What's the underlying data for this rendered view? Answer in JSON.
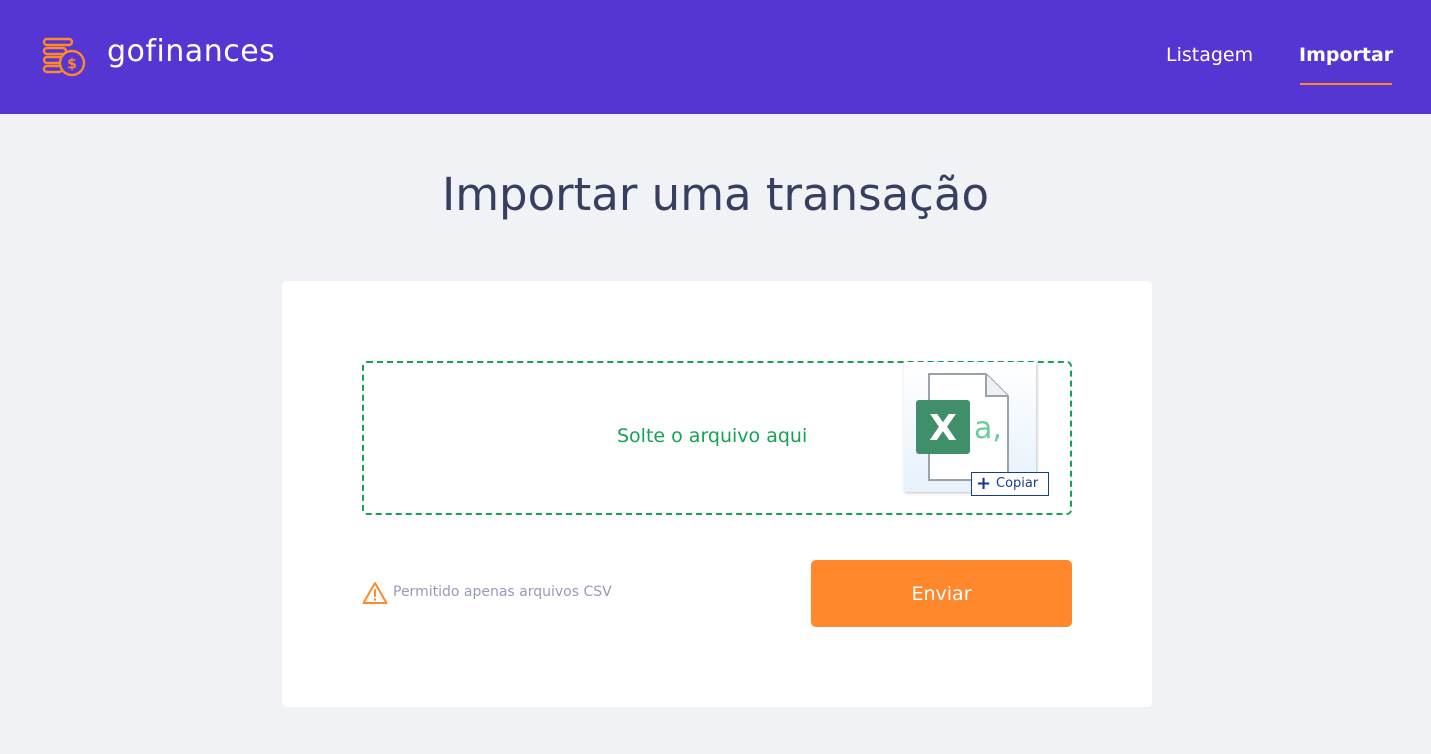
{
  "header": {
    "brand": "gofinances",
    "nav": [
      {
        "label": "Listagem",
        "active": false
      },
      {
        "label": "Importar",
        "active": true
      }
    ],
    "colors": {
      "background": "#5636d3",
      "accent": "#ff872c"
    },
    "logo_icon": "money-coins-icon"
  },
  "main": {
    "title": "Importar uma transação",
    "dropzone": {
      "text": "Solte o arquivo aqui",
      "drag_preview": {
        "file_icon": "excel-file-icon",
        "excel_letter": "X",
        "glyph": "a,",
        "copy_label": "Copiar"
      }
    },
    "hint": {
      "icon": "alert-triangle-icon",
      "text": "Permitido apenas arquivos CSV"
    },
    "submit_label": "Enviar"
  }
}
